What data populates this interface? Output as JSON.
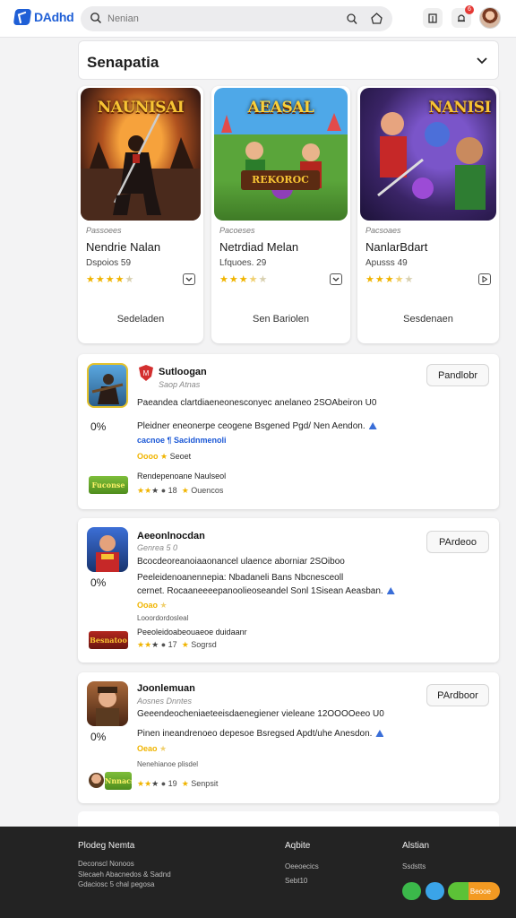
{
  "header": {
    "logo_text": "DAdhd",
    "search_placeholder": "Nenian"
  },
  "notifications": {
    "count": "6"
  },
  "section": {
    "title": "Senapatia"
  },
  "featured": [
    {
      "art_title": "NAUNISAI",
      "meta": "Passoees",
      "name": "Nendrie Nalan",
      "sub": "Dspoios 59",
      "stars": 4,
      "button": "Sedeladen"
    },
    {
      "art_title": "AEASAL",
      "art_banner": "REKOROC",
      "meta": "Pacoeses",
      "name": "Netrdiad Melan",
      "sub": "Lfquoes. 29",
      "stars": 3.5,
      "button": "Sen Bariolen"
    },
    {
      "art_title": "NANISI",
      "meta": "Pacsoaes",
      "name": "NanlarBdart",
      "sub": "Apusss 49",
      "stars": 3.5,
      "button": "Sesdenaen"
    }
  ],
  "apps": [
    {
      "name": "Sutloogan",
      "dev": "Saop Atnas",
      "desc1": "Paeandea clartdiaeneonesconyec anelaneo 2SOAbeiron U0",
      "pct": "0%",
      "desc2": "Pleidner eneonerpe ceogene Bsgened Pgd/ Nen Aendon.",
      "link": "cacnoe ¶ Sacidnmenoli",
      "badge": "Oooo",
      "badge_suffix": "Seoet",
      "tag": "Fuconse",
      "note": "Rendepenoane Naulseol",
      "stats_count": "18",
      "stats_label": "Ouencos",
      "button": "Pandlobr"
    },
    {
      "name": "Aeeonlnocdan",
      "dev": "Genrea 5 0",
      "desc1": "Bcocdeoreanoiaaonancel ulaence aborniar 2SOiboo",
      "pct": "0%",
      "desc2": "Peeleidenoanennepia: Nbadaneli Bans Nbcnesceoll",
      "desc3": "cernet. Rocaaneeeepanoolieoseandel Sonl 1Sisean Aeasban.",
      "badge": "Ooao",
      "note_small": "Looordordosleal",
      "note": "Peeoleidoabeouaeoe duidaanr",
      "tag": "Besnatoo",
      "stats_count": "17",
      "stats_label": "Sogrsd",
      "button": "PArdeoo"
    },
    {
      "name": "Joonlemuan",
      "dev": "Aosnes Dnntes",
      "desc1": "Geeendeocheniaeteeisdaenegiener vieleane 12OOOOeeo U0",
      "pct": "0%",
      "desc2": "Pinen ineandrenoeo depesoe Bsregsed Apdt/uhe Anesdon.",
      "badge": "Oeao",
      "note_small": "Nenehianoe plisdel",
      "tag": "Nnnacs",
      "stats_count": "19",
      "stats_label": "Senpsit",
      "button": "PArdboor"
    }
  ],
  "footer": {
    "col1_title": "Plodeg Nemta",
    "col1_lines": [
      "Deconscl Nonoos",
      "Slecaeh Abacnedos & Sadnd",
      "Gdaciosc 5 chal pegosa"
    ],
    "col2_title": "Aqbite",
    "col2_lines": [
      "Oeeoecics",
      "Sebt10"
    ],
    "col3_title": "Alstian",
    "col3_lines": [
      "Ssdstts"
    ],
    "cta_label": "Beooe"
  },
  "colors": {
    "accent": "#1f5fd6",
    "star": "#f0b400",
    "footer_bg": "#232323"
  }
}
